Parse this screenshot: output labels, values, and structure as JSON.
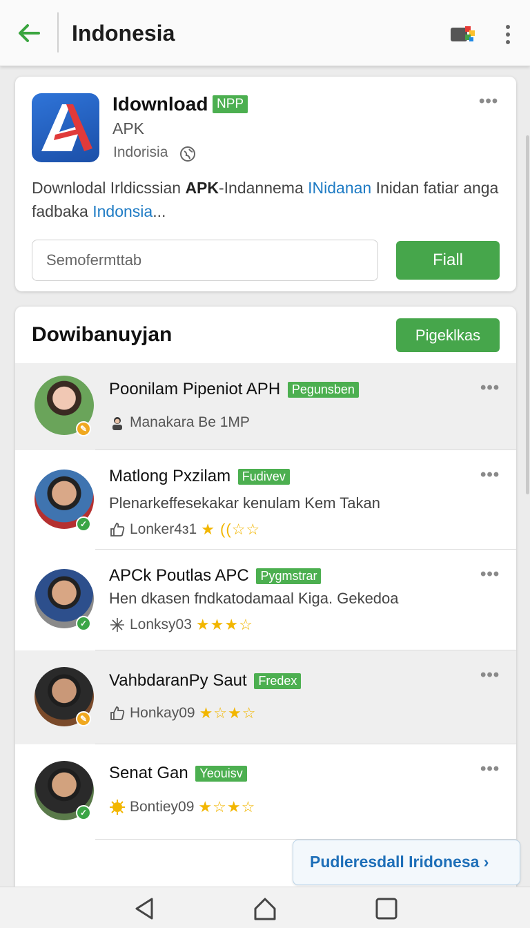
{
  "appbar": {
    "title": "Indonesia"
  },
  "app_card": {
    "name": "Idownload",
    "tag": "NPP",
    "type": "APK",
    "region": "Indorisia",
    "desc_part1": "Downlodal Irldicssian ",
    "desc_bold": "APK",
    "desc_part2": "-Indannema ",
    "desc_link1": "INidanan",
    "desc_part3": " Inidan fatiar anga fadbaka ",
    "desc_link2": "Indonsia",
    "desc_part4": "...",
    "search_placeholder": "Semofermttab",
    "find_label": "Fiall"
  },
  "section": {
    "title": "Dowibanuyjan",
    "button_label": "Pigeklkas"
  },
  "items": [
    {
      "name": "Poonilam Pipeniot APH",
      "tag": "Pegunsben",
      "sub": "",
      "meta": "Manakara Be 1MP",
      "stars": ""
    },
    {
      "name": "Matlong Pxzilam",
      "tag": "Fudivev",
      "sub": "Plenarkeffesekakar kenulam Kem Takan",
      "meta": "Lonker4ɜ1",
      "stars": "★ ((☆☆"
    },
    {
      "name": "APCk Poutlas APC",
      "tag": "Pygmstrar",
      "sub": "Hen dkasen fndkatodamaal Kiga. Gekedoa",
      "meta": "Lonksy03",
      "stars": "★★★☆"
    },
    {
      "name": "VahbdaranPy Saut",
      "tag": "Fredex",
      "sub": "",
      "meta": "Honkay09",
      "stars": "★☆★☆"
    },
    {
      "name": "Senat Gan",
      "tag": "Yeouisv",
      "sub": "",
      "meta": "Bontiey09",
      "stars": "★☆★☆"
    }
  ],
  "footer_link": "Pudleresdall Iridonesa ›",
  "colors": {
    "accent": "#46a64b",
    "link": "#1e7bc4",
    "star": "#f2b600"
  }
}
